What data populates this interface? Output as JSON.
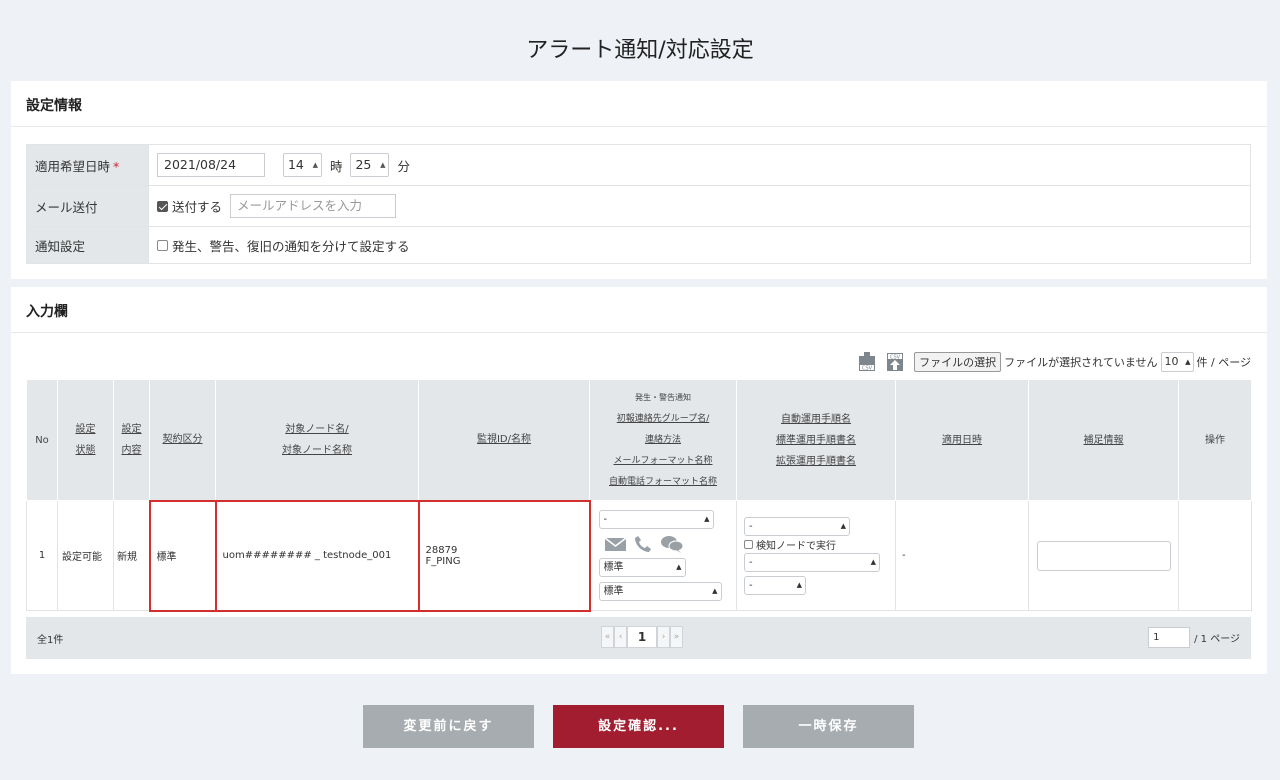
{
  "page": {
    "title": "アラート通知/対応設定"
  },
  "settings": {
    "header": "設定情報",
    "rows": {
      "apply_date": {
        "label": "適用希望日時",
        "required_mark": "*",
        "date": "2021/08/24",
        "hour": "14",
        "hour_unit": "時",
        "minute": "25",
        "minute_unit": "分"
      },
      "mail": {
        "label": "メール送付",
        "checkbox_label": "送付する",
        "checked": true,
        "email_placeholder": "メールアドレスを入力"
      },
      "notify": {
        "label": "通知設定",
        "checkbox_label": "発生、警告、復旧の通知を分けて設定する",
        "checked": false
      }
    }
  },
  "input": {
    "header": "入力欄",
    "toolbar": {
      "csv_label": "CSV",
      "file_button": "ファイルの選択",
      "file_status": "ファイルが選択されていません",
      "per_page": "10",
      "per_page_suffix": "件 / ページ"
    },
    "columns": {
      "no": "No",
      "status": [
        "設定",
        "状態"
      ],
      "content": [
        "設定",
        "内容"
      ],
      "contract": "契約区分",
      "node": [
        "対象ノード名/",
        "対象ノード名称"
      ],
      "monitor": "監視ID/名称",
      "notify_title": "発生・警告通知",
      "notify": [
        "初報連絡先グループ名/",
        "連絡方法",
        "メールフォーマット名称",
        "自動電話フォーマット名称"
      ],
      "auto": [
        "自動運用手順名",
        "標準運用手順書名",
        "拡張運用手順書名"
      ],
      "apply_date": "適用日時",
      "supplement": "補足情報",
      "operation": "操作"
    },
    "row": {
      "no": "1",
      "status": "設定可能",
      "content": "新規",
      "contract": "標準",
      "node": "uom######## _ testnode_001",
      "monitor_id": "28879",
      "monitor_name": "F_PING",
      "notify_group": "-",
      "mail_format": "標準",
      "phone_format": "標準",
      "auto_proc": "-",
      "detect_node_label": "検知ノードで実行",
      "std_manual": "-",
      "ext_manual": "-",
      "apply_date": "-"
    },
    "footer": {
      "count": "全1件",
      "page": "1",
      "page_input": "1",
      "page_total": "/ 1 ページ"
    }
  },
  "buttons": {
    "revert": "変更前に戻す",
    "confirm": "設定確認...",
    "temp_save": "一時保存"
  },
  "colors": {
    "confirm": "#a11d2f",
    "gray": "#a6acaf",
    "highlight": "#d32f2f"
  }
}
